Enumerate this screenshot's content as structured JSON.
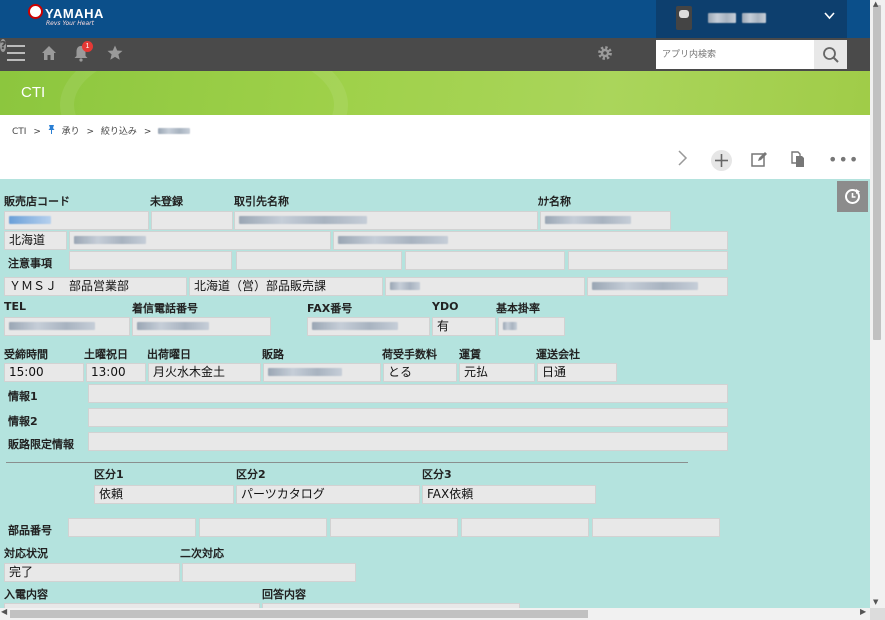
{
  "brand": {
    "name": "YAMAHA",
    "tagline": "Revs Your Heart"
  },
  "icons": {
    "menu": "hamburger-icon",
    "home": "home-icon",
    "notifications": "bell-icon",
    "favorites": "star-icon",
    "settings": "gear-icon",
    "help": "question-icon",
    "search": "search-icon",
    "next": "chevron-right-icon",
    "add": "plus-icon",
    "edit": "edit-icon",
    "copy": "copy-icon",
    "more": "more-icon",
    "reload": "reload-icon",
    "user_menu": "chevron-down-icon"
  },
  "toolbar": {
    "notification_count": "1",
    "help_glyph": "?"
  },
  "search": {
    "placeholder": "アプリ内検索"
  },
  "app": {
    "title": "CTI"
  },
  "breadcrumb": {
    "items": [
      "CTI",
      ">",
      "承り",
      ">",
      "絞り込み",
      ">"
    ]
  },
  "actions": {
    "more_glyph": "•••"
  },
  "form": {
    "labels": {
      "dealer_code": "販売店コード",
      "unregistered": "未登録",
      "partner_name": "取引先名称",
      "kana_name": "ｶﾅ名称",
      "notes": "注意事項",
      "tel": "TEL",
      "incoming_tel": "着信電話番号",
      "fax": "FAX番号",
      "ydo": "YDO",
      "base_rate": "基本掛率",
      "cutoff_time": "受締時間",
      "holiday": "土曜祝日",
      "ship_days": "出荷曜日",
      "route": "販路",
      "handling_fee": "荷受手数料",
      "freight": "運賃",
      "carrier": "運送会社",
      "info1": "情報1",
      "info2": "情報2",
      "route_limit": "販路限定情報",
      "category1": "区分1",
      "category2": "区分2",
      "category3": "区分3",
      "part_number": "部品番号",
      "status": "対応状況",
      "secondary": "二次対応",
      "call_content": "入電内容",
      "answer_content": "回答内容"
    },
    "values": {
      "region": "北海道",
      "company": "ＹＭＳＪ　部品営業部",
      "department": "北海道（営）部品販売課",
      "ydo": "有",
      "cutoff_time": "15:00",
      "holiday": "13:00",
      "ship_days": "月火水木金土",
      "handling_fee": "とる",
      "freight": "元払",
      "carrier": "日通",
      "category1": "依頼",
      "category2": "パーツカタログ",
      "category3": "FAX依頼",
      "status": "完了"
    }
  },
  "colors": {
    "brand_bar": "#0b4f8a",
    "toolbar": "#4a4a4a",
    "banner": "#9fd14a",
    "record_bg": "#b4e3de",
    "field_bg": "#e8e8e8",
    "badge": "#e53935"
  }
}
